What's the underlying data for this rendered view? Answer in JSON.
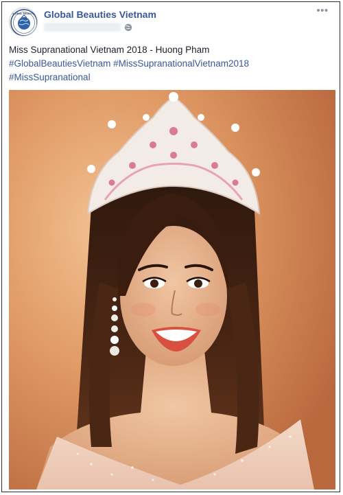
{
  "post": {
    "page_name": "Global Beauties Vietnam",
    "avatar_label": "GLOBAL BEAUTIES",
    "more_label": "•••",
    "text": {
      "caption": "Miss Supranational Vietnam 2018 - Huong Pham",
      "hashtags_line1": "#GlobalBeautiesVietnam #MissSupranationalVietnam2018",
      "hashtags_line2": "#MissSupranational"
    }
  },
  "colors": {
    "link": "#385898",
    "text": "#1d2129",
    "photo_background": "#e29c6b"
  },
  "icons": {
    "audience": "globe-icon",
    "menu": "more-options-icon"
  }
}
